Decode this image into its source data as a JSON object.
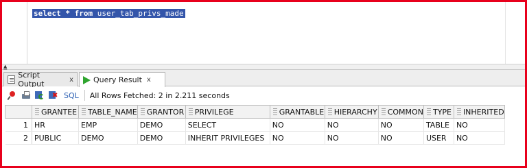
{
  "editor": {
    "query_keyword_select": "select",
    "query_star": "*",
    "query_keyword_from": "from",
    "query_table": "user_tab_privs_made"
  },
  "tabs": [
    {
      "label": "Script Output",
      "close": "x",
      "icon": "script-icon",
      "active": false
    },
    {
      "label": "Query Result",
      "close": "x",
      "icon": "play-icon",
      "active": true
    }
  ],
  "toolbar": {
    "sql_label": "SQL",
    "status": "All Rows Fetched: 2 in 2.211 seconds",
    "icons": [
      "pin-icon",
      "print-icon",
      "refresh-icon",
      "cancel-icon"
    ]
  },
  "grid": {
    "columns": [
      "GRANTEE",
      "TABLE_NAME",
      "GRANTOR",
      "PRIVILEGE",
      "GRANTABLE",
      "HIERARCHY",
      "COMMON",
      "TYPE",
      "INHERITED"
    ],
    "rows": [
      {
        "num": "1",
        "cells": [
          "HR",
          "EMP",
          "DEMO",
          "SELECT",
          "NO",
          "NO",
          "NO",
          "TABLE",
          "NO"
        ]
      },
      {
        "num": "2",
        "cells": [
          "PUBLIC",
          "DEMO",
          "DEMO",
          "INHERIT PRIVILEGES",
          "NO",
          "NO",
          "NO",
          "USER",
          "NO"
        ]
      }
    ]
  },
  "colors": {
    "frame": "#e8001c",
    "selection": "#3355aa",
    "run_icon": "#2fa52f",
    "sql_link": "#2b5fb3"
  }
}
